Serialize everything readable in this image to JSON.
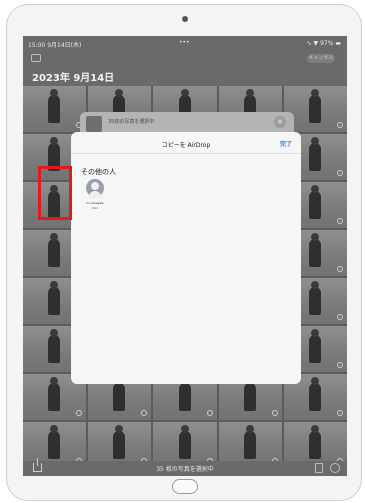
{
  "status_bar": {
    "time": "15:00 9月14日(木)",
    "dots": "•••",
    "battery": "∿ ▼ 97% ▬"
  },
  "top_bar": {
    "select_label": "キャンセル"
  },
  "library": {
    "date_title": "2023年 9月14日",
    "photo_count": 40
  },
  "share_sheet": {
    "subtitle": "35枚の写真を選択中",
    "close_label": "×"
  },
  "airdrop_sheet": {
    "title": "コピーを AirDrop",
    "done_label": "完了",
    "section_label": "その他の人",
    "device": {
      "name": "m-nakagaw",
      "sub": "iPad"
    }
  },
  "bottom_bar": {
    "status": "35 枚の写真を選択中"
  },
  "colors": {
    "highlight": "#e01b1b",
    "accent": "#2f7ae5"
  }
}
